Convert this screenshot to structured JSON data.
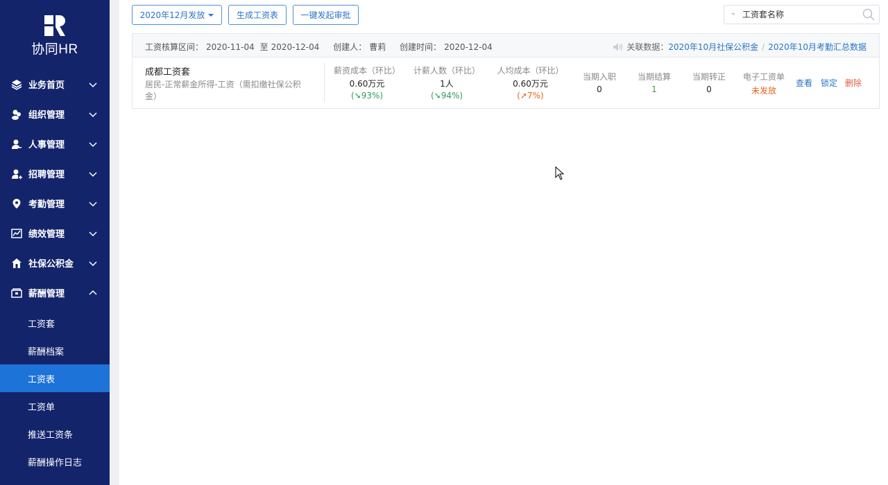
{
  "sidebar": {
    "logo_text": "协同HR",
    "items": [
      {
        "label": "业务首页",
        "icon": "layers-icon",
        "expanded": false
      },
      {
        "label": "组织管理",
        "icon": "org-icon",
        "expanded": false
      },
      {
        "label": "人事管理",
        "icon": "person-icon",
        "expanded": false
      },
      {
        "label": "招聘管理",
        "icon": "person-add-icon",
        "expanded": false
      },
      {
        "label": "考勤管理",
        "icon": "location-pin-icon",
        "expanded": false
      },
      {
        "label": "绩效管理",
        "icon": "chart-icon",
        "expanded": false
      },
      {
        "label": "社保公积金",
        "icon": "house-icon",
        "expanded": false
      },
      {
        "label": "薪酬管理",
        "icon": "wallet-icon",
        "expanded": true
      }
    ],
    "sub_items": [
      {
        "label": "工资套",
        "active": false
      },
      {
        "label": "薪酬档案",
        "active": false
      },
      {
        "label": "工资表",
        "active": true
      },
      {
        "label": "工资单",
        "active": false
      },
      {
        "label": "推送工资条",
        "active": false
      },
      {
        "label": "薪酬操作日志",
        "active": false
      }
    ]
  },
  "toolbar": {
    "period_label": "2020年12月发放",
    "generate_label": "生成工资表",
    "approve_label": "一键发起审批"
  },
  "search": {
    "placeholder": "工资套名称"
  },
  "card": {
    "period_label": "工资核算区间：",
    "period_start": "2020-11-04",
    "period_to": "至",
    "period_end": "2020-12-04",
    "creator_label": "创建人：",
    "creator": "曹莉",
    "created_label": "创建时间：",
    "created_date": "2020-12-04",
    "related_label": "关联数据：",
    "related_links": [
      "2020年10月社保公积金",
      "2020年10月考勤汇总数据"
    ],
    "link_separator": "/",
    "name": "成都工资套",
    "description": "居民-正常薪金所得-工资（需扣缴社保公积金）",
    "stats": [
      {
        "label": "薪资成本（环比）",
        "value": "0.60万元",
        "change": "93%",
        "direction": "down"
      },
      {
        "label": "计薪人数（环比）",
        "value": "1人",
        "change": "94%",
        "direction": "down"
      },
      {
        "label": "人均成本（环比）",
        "value": "0.60万元",
        "change": "7%",
        "direction": "up"
      }
    ],
    "minis": [
      {
        "label": "当期入职",
        "value": "0"
      },
      {
        "label": "当期结算",
        "value": "1"
      },
      {
        "label": "当期转正",
        "value": "0"
      },
      {
        "label": "电子工资单",
        "value": "未发放"
      }
    ],
    "actions": {
      "view": "查看",
      "lock": "锁定",
      "delete": "删除"
    }
  },
  "colors": {
    "sidebar_bg": "#13246b",
    "active_bg": "#1e73d8",
    "link": "#2a74c7",
    "down": "#2d9a63",
    "up": "#e2651f"
  }
}
